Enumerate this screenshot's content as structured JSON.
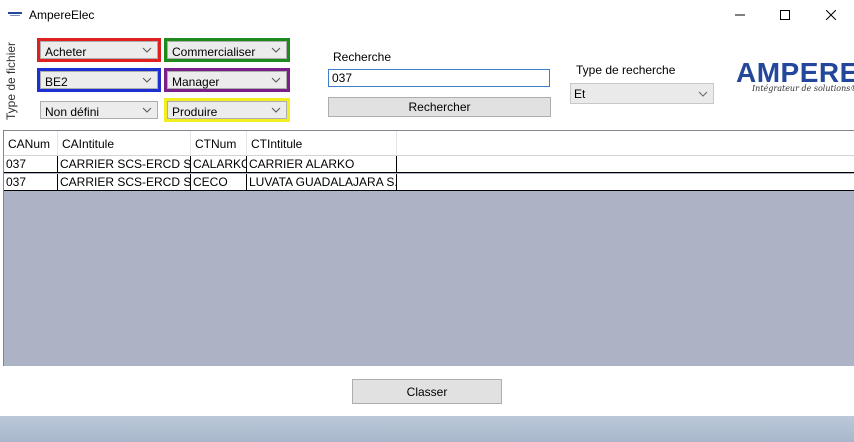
{
  "window": {
    "title": "AmpereElec",
    "icon": "app-logo-icon",
    "controls": [
      "minimize-icon",
      "maximize-icon",
      "close-icon"
    ]
  },
  "sidebar_label": "Type de fichier",
  "combos": {
    "acheter": "Acheter",
    "commercialiser": "Commercialiser",
    "be2": "BE2",
    "manager": "Manager",
    "non_defini": "Non défini",
    "produire": "Produire"
  },
  "colors": {
    "red": "#e02020",
    "green": "#1e8a1e",
    "blue": "#1c2fd0",
    "purple": "#7a1f8a",
    "yellow": "#f2ee22",
    "brand": "#23479a"
  },
  "search": {
    "label": "Recherche",
    "value": "037",
    "button": "Rechercher"
  },
  "search_type": {
    "label": "Type de recherche",
    "value": "Et"
  },
  "logo": {
    "name": "AMPERE",
    "tagline": "Intégrateur de solutions®"
  },
  "table": {
    "columns": [
      "CANum",
      "CAIntitule",
      "CTNum",
      "CTIntitule"
    ],
    "rows": [
      [
        "037",
        "CARRIER SCS-ERCD SAV",
        "CALARKO",
        "CARRIER ALARKO"
      ],
      [
        "037",
        "CARRIER SCS-ERCD SAV",
        "CECO",
        "LUVATA GUADALAJARA S.A"
      ]
    ]
  },
  "footer": {
    "classer_button": "Classer"
  }
}
